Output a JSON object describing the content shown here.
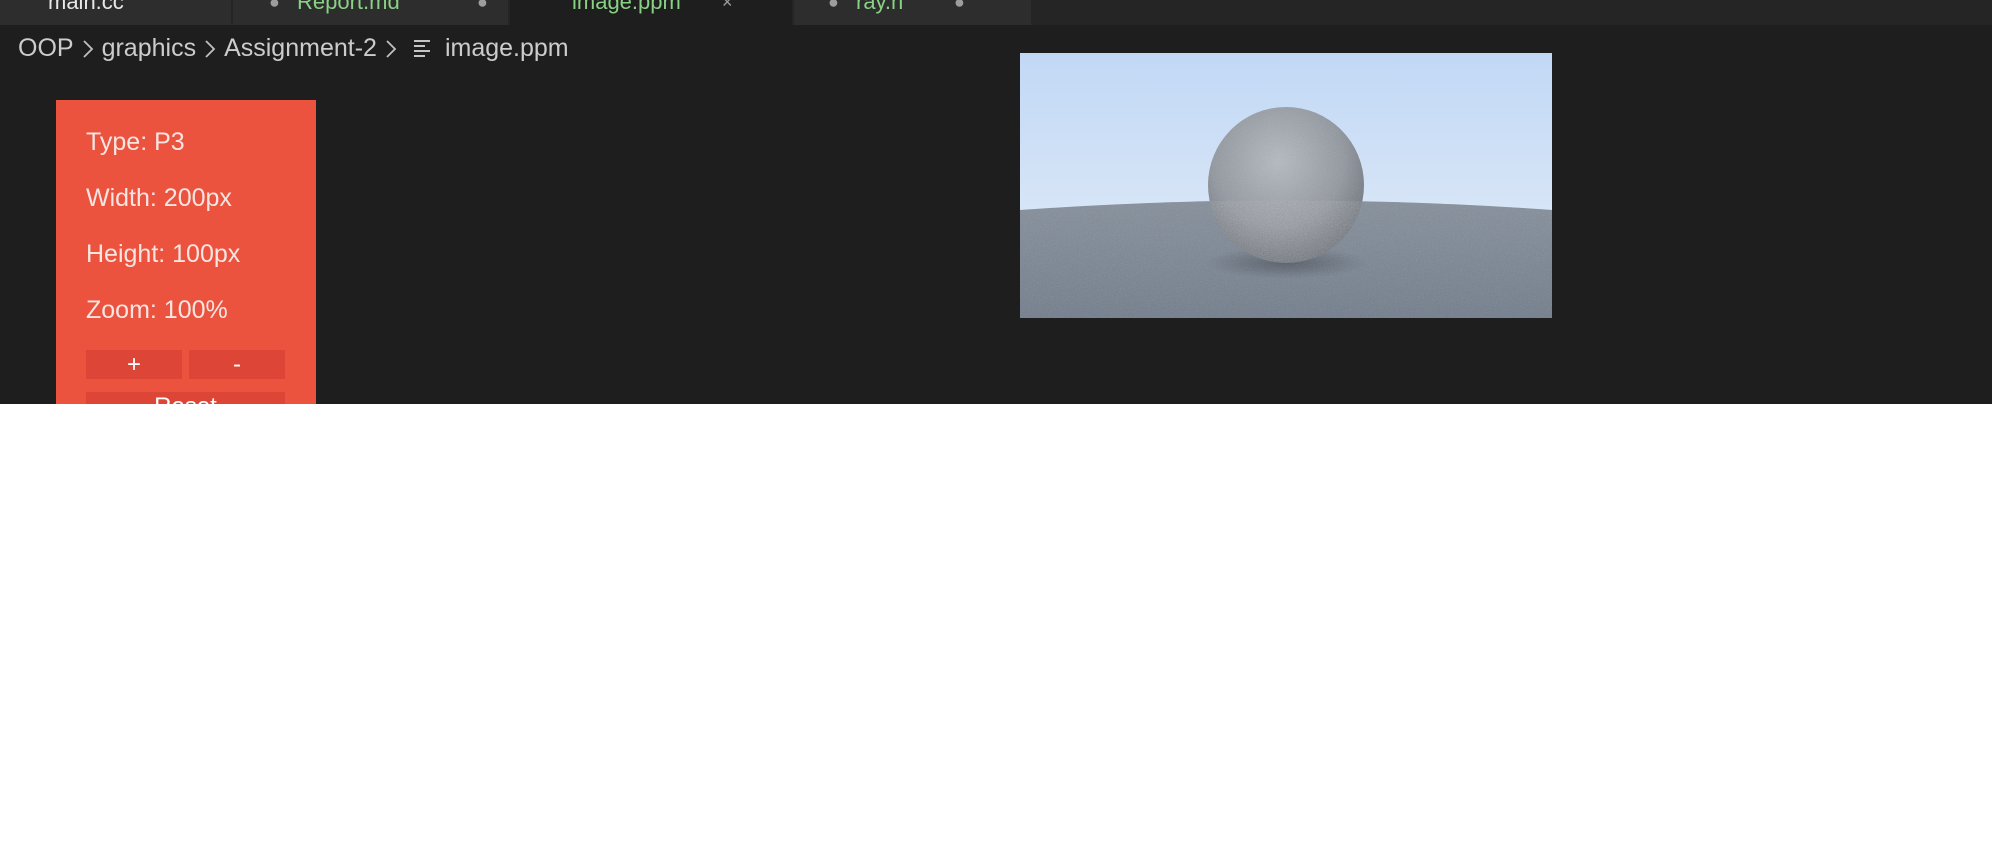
{
  "tabs": [
    {
      "label": "main.cc",
      "close": "",
      "color": "#e8e8e8",
      "active": false
    },
    {
      "label": "Report.md",
      "close": "●",
      "color": "#89d185",
      "active": false
    },
    {
      "label": "image.ppm",
      "close": "×",
      "color": "#89d185",
      "active": true
    },
    {
      "label": "ray.h",
      "close": "●",
      "color": "#89d185",
      "active": false
    }
  ],
  "breadcrumb": {
    "items": [
      "OOP",
      "graphics",
      "Assignment-2"
    ],
    "file": "image.ppm",
    "file_icon": "lines-icon"
  },
  "info": {
    "type": "Type: P3",
    "width": "Width: 200px",
    "height": "Height: 100px",
    "zoom": "Zoom: 100%",
    "zoom_in_label": "+",
    "zoom_out_label": "-",
    "reset_label": "Reset"
  },
  "colors": {
    "editor_bg": "#1e1e1e",
    "tab_bar_bg": "#252526",
    "panel_bg": "#ec533f",
    "panel_button_bg": "#dd4636",
    "modified_tab_text": "#89d185"
  }
}
